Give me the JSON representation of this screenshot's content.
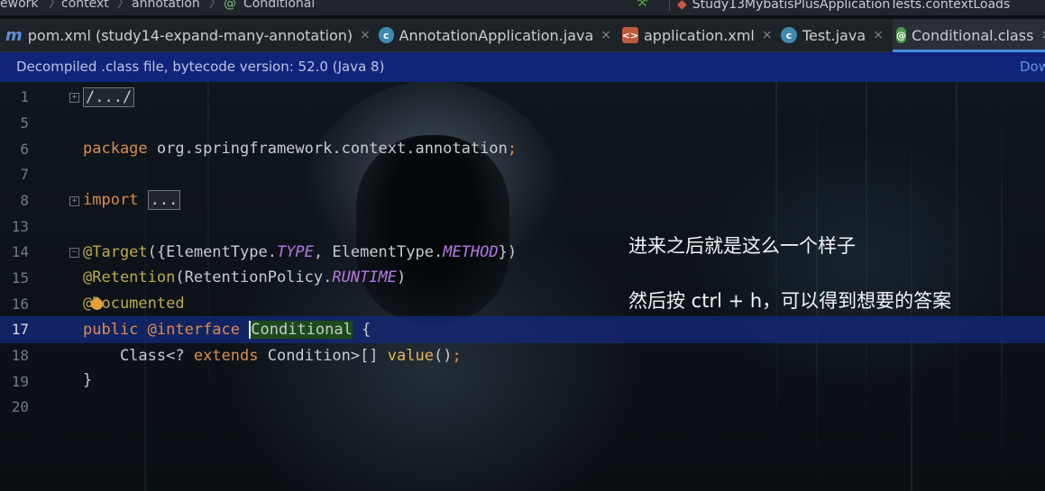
{
  "breadcrumb": {
    "items": [
      "ework",
      "context",
      "annotation",
      "Conditional"
    ],
    "run_config": "Study13MybatisPlusApplicationTests.contextLoads"
  },
  "tabs": [
    {
      "label": "pom.xml (study14-expand-many-annotation)",
      "icon": "maven-icon",
      "active": false
    },
    {
      "label": "AnnotationApplication.java",
      "icon": "spring-class-icon",
      "active": false
    },
    {
      "label": "application.xml",
      "icon": "xml-file-icon",
      "active": false
    },
    {
      "label": "Test.java",
      "icon": "class-icon",
      "active": false
    },
    {
      "label": "Conditional.class",
      "icon": "annotation-icon",
      "active": true
    }
  ],
  "banner": {
    "text": "Decompiled .class file, bytecode version: 52.0 (Java 8)",
    "link": "Dow"
  },
  "editor": {
    "line_numbers": [
      "1",
      "5",
      "6",
      "7",
      "8",
      "13",
      "14",
      "15",
      "16",
      "17",
      "18",
      "19",
      "20"
    ],
    "current_line": "17",
    "lines": {
      "l1_folded": "/.../",
      "l6_kw": "package",
      "l6_pkg": " org.springframework.context.annotation",
      "l6_semi": ";",
      "l8_kw": "import",
      "l8_folded": "...",
      "l14_ann": "@Target",
      "l14_a": "({ElementType.",
      "l14_type": "TYPE",
      "l14_b": ", ElementType.",
      "l14_method": "METHOD",
      "l14_c": "})",
      "l15_ann": "@Retention",
      "l15_a": "(RetentionPolicy.",
      "l15_runtime": "RUNTIME",
      "l15_b": ")",
      "l16_ann": "@Documented",
      "l17_kw1": "public",
      "l17_kw2": " @interface ",
      "l17_name": "Conditional",
      "l17_rest": " {",
      "l18_a": "    Class<? ",
      "l18_kw": "extends",
      "l18_b": " Condition>[] ",
      "l18_fn": "value",
      "l18_c": "()",
      "l18_semi": ";",
      "l19": "}"
    }
  },
  "overlay": {
    "line1": "进来之后就是这么一个样子",
    "line2": "然后按 ctrl + h，可以得到想要的答案"
  }
}
